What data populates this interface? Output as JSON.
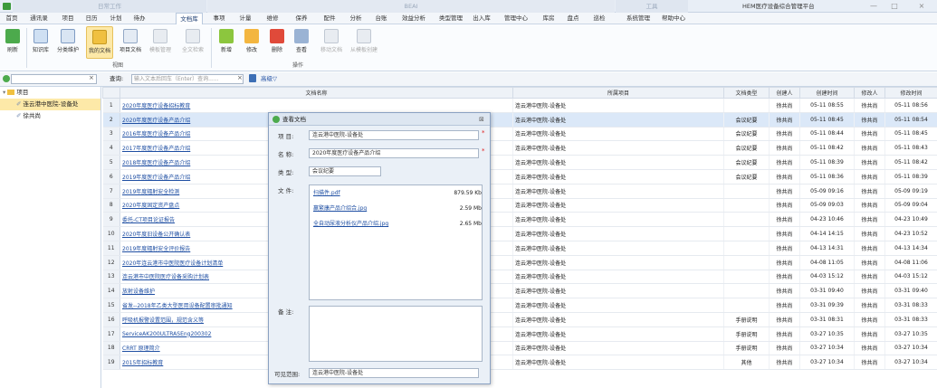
{
  "titlebar": {
    "groups": [
      "日常工作",
      "BEAI",
      "工具"
    ],
    "app_title": "HEM医疗设备综合管理平台",
    "min": "—",
    "max": "□",
    "close": "×"
  },
  "menu": [
    "首页",
    "通讯录",
    "项目",
    "日历",
    "计划",
    "待办",
    "文档库",
    "事项",
    "计量",
    "维修",
    "保养",
    "配件",
    "分析",
    "台账",
    "效益分析",
    "类型管理",
    "出入库",
    "管理中心",
    "库房",
    "盘点",
    "巡检",
    "系统管理",
    "帮助中心"
  ],
  "ribbon": {
    "btn_refresh": "刷新",
    "btn_kb": "知识库",
    "btn_category": "分类维护",
    "btn_mydocs": "我的文档",
    "btn_projdocs": "项目文档",
    "btn_template": "模板管理",
    "btn_fulltext": "全文检索",
    "group_view": "视图",
    "btn_add": "新增",
    "btn_edit": "修改",
    "btn_delete": "删除",
    "btn_view": "查看",
    "btn_move": "移动文档",
    "btn_fromtemplate": "从模板创建",
    "group_ops": "操作"
  },
  "filter": {
    "query_label": "查询:",
    "placeholder": "输入文本后回车（Enter）查询......",
    "advanced": "高级▽"
  },
  "tree": {
    "root": "项目",
    "items": [
      "连云港中医院-设备处",
      "徐共尚"
    ]
  },
  "grid": {
    "headers": [
      "",
      "文档名称",
      "所属项目",
      "文档类型",
      "创建人",
      "创建时间",
      "修改人",
      "修改时间"
    ],
    "rows": [
      {
        "n": "1",
        "name": "2020年度医疗设备招标教育",
        "proj": "连云港中医院-设备处",
        "type": "",
        "creator": "徐共尚",
        "ctime": "05-11 08:55",
        "modifier": "徐共尚",
        "mtime": "05-11 08:56"
      },
      {
        "n": "2",
        "name": "2020年度医疗设备产品介绍",
        "proj": "连云港中医院-设备处",
        "type": "会议纪要",
        "creator": "徐共尚",
        "ctime": "05-11 08:45",
        "modifier": "徐共尚",
        "mtime": "05-11 08:54"
      },
      {
        "n": "3",
        "name": "2016年度医疗设备产品介绍",
        "proj": "连云港中医院-设备处",
        "type": "会议纪要",
        "creator": "徐共尚",
        "ctime": "05-11 08:44",
        "modifier": "徐共尚",
        "mtime": "05-11 08:45"
      },
      {
        "n": "4",
        "name": "2017年度医疗设备产品介绍",
        "proj": "连云港中医院-设备处",
        "type": "会议纪要",
        "creator": "徐共尚",
        "ctime": "05-11 08:42",
        "modifier": "徐共尚",
        "mtime": "05-11 08:43"
      },
      {
        "n": "5",
        "name": "2018年度医疗设备产品介绍",
        "proj": "连云港中医院-设备处",
        "type": "会议纪要",
        "creator": "徐共尚",
        "ctime": "05-11 08:39",
        "modifier": "徐共尚",
        "mtime": "05-11 08:42"
      },
      {
        "n": "6",
        "name": "2019年度医疗设备产品介绍",
        "proj": "连云港中医院-设备处",
        "type": "会议纪要",
        "creator": "徐共尚",
        "ctime": "05-11 08:36",
        "modifier": "徐共尚",
        "mtime": "05-11 08:39"
      },
      {
        "n": "7",
        "name": "2019年度辐射安全检测",
        "proj": "连云港中医院-设备处",
        "type": "",
        "creator": "徐共尚",
        "ctime": "05-09 09:16",
        "modifier": "徐共尚",
        "mtime": "05-09 09:19"
      },
      {
        "n": "8",
        "name": "2020年度固定资产盘点",
        "proj": "连云港中医院-设备处",
        "type": "",
        "creator": "徐共尚",
        "ctime": "05-09 09:03",
        "modifier": "徐共尚",
        "mtime": "05-09 09:04"
      },
      {
        "n": "9",
        "name": "委托-CT项目论证报告",
        "proj": "连云港中医院-设备处",
        "type": "",
        "creator": "徐共尚",
        "ctime": "04-23 10:46",
        "modifier": "徐共尚",
        "mtime": "04-23 10:49"
      },
      {
        "n": "10",
        "name": "2020年度旧设备公开确认表",
        "proj": "连云港中医院-设备处",
        "type": "",
        "creator": "徐共尚",
        "ctime": "04-14 14:15",
        "modifier": "徐共尚",
        "mtime": "04-23 10:52"
      },
      {
        "n": "11",
        "name": "2019年度辐射安全评价报告",
        "proj": "连云港中医院-设备处",
        "type": "",
        "creator": "徐共尚",
        "ctime": "04-13 14:31",
        "modifier": "徐共尚",
        "mtime": "04-13 14:34"
      },
      {
        "n": "12",
        "name": "2020年连云港市中医院医疗设备计划清单",
        "proj": "连云港中医院-设备处",
        "type": "",
        "creator": "徐共尚",
        "ctime": "04-08 11:05",
        "modifier": "徐共尚",
        "mtime": "04-08 11:06"
      },
      {
        "n": "13",
        "name": "连云港市中医院医疗设备采购计划表",
        "proj": "连云港中医院-设备处",
        "type": "",
        "creator": "徐共尚",
        "ctime": "04-03 15:12",
        "modifier": "徐共尚",
        "mtime": "04-03 15:12"
      },
      {
        "n": "14",
        "name": "放射设备维护",
        "proj": "连云港中医院-设备处",
        "type": "",
        "creator": "徐共尚",
        "ctime": "03-31 09:40",
        "modifier": "徐共尚",
        "mtime": "03-31 09:40"
      },
      {
        "n": "15",
        "name": "省发--2018年乙类大型医用设备配置审批通知",
        "proj": "连云港中医院-设备处",
        "type": "",
        "creator": "徐共尚",
        "ctime": "03-31 09:39",
        "modifier": "徐共尚",
        "mtime": "03-31 08:33"
      },
      {
        "n": "16",
        "name": "呼吸机报警设置范围，规范含义等",
        "proj": "连云港中医院-设备处",
        "type": "手册说明",
        "creator": "徐共尚",
        "ctime": "03-31 08:31",
        "modifier": "徐共尚",
        "mtime": "03-31 08:33"
      },
      {
        "n": "17",
        "name": "ServiceAK200ULTRASEng200302",
        "proj": "连云港中医院-设备处",
        "type": "手册说明",
        "creator": "徐共尚",
        "ctime": "03-27 10:35",
        "modifier": "徐共尚",
        "mtime": "03-27 10:35"
      },
      {
        "n": "18",
        "name": "CRRT 原理简介",
        "proj": "连云港中医院-设备处",
        "type": "手册说明",
        "creator": "徐共尚",
        "ctime": "03-27 10:34",
        "modifier": "徐共尚",
        "mtime": "03-27 10:34"
      },
      {
        "n": "19",
        "name": "2015年招标教育",
        "proj": "连云港中医院-设备处",
        "type": "其他",
        "creator": "徐共尚",
        "ctime": "03-27 10:34",
        "modifier": "徐共尚",
        "mtime": "03-27 10:34"
      }
    ]
  },
  "dialog": {
    "title": "查看文档",
    "close": "⊠",
    "project_label": "项 目:",
    "project_value": "连云港中医院-设备处",
    "name_label": "名 称:",
    "name_value": "2020年度医疗设备产品介绍",
    "type_label": "类 型:",
    "type_value": "会议纪要",
    "file_label": "文 件:",
    "files": [
      {
        "name": "扫描件.pdf",
        "size": "879.59 Kb"
      },
      {
        "name": "赢繁康产品介绍合.jpg",
        "size": "2.59 Mb"
      },
      {
        "name": "全自动尿液分析仪产品介绍.jpg",
        "size": "2.65 Mb"
      }
    ],
    "remark_label": "备 注:",
    "scope_label": "可见范围:",
    "scope_value": "连云港中医院-设备处",
    "required_mark": "*"
  },
  "colors": {
    "accent": "#1f4fa3",
    "selected_row": "#dbe8f8",
    "ribbon_selected": "#fde9a8"
  }
}
